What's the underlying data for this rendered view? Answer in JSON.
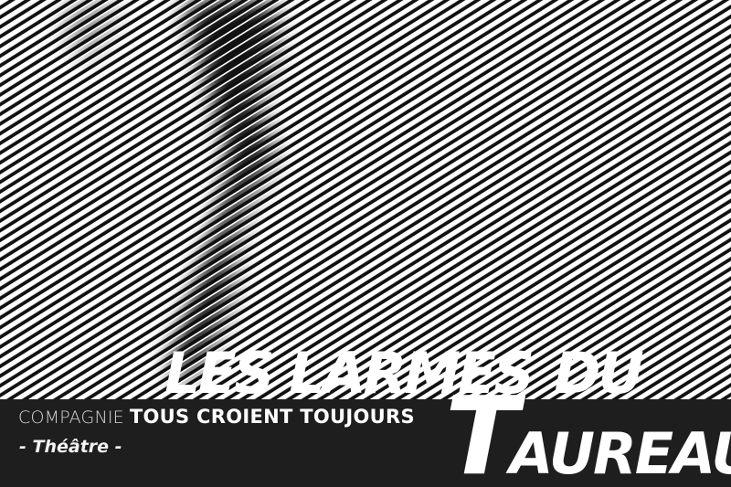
{
  "poster": {
    "title": {
      "line1_words": [
        "LES LARMES",
        "DU"
      ],
      "line2_initial": "T",
      "line2_rest": "AUREAU"
    },
    "company": {
      "prefix": "COMPAGNIE",
      "name": "TOUS CROIENT TOUJOURS"
    },
    "genre": "- Théâtre -"
  },
  "colors": {
    "stripe_light": "#ffffff",
    "stripe_dark": "#111111",
    "band": "#1e1e1e",
    "text": "#ffffff"
  }
}
